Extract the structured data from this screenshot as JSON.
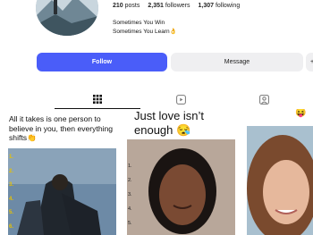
{
  "profile": {
    "posts_count": "210",
    "posts_label": "posts",
    "followers_count": "2,351",
    "followers_label": "followers",
    "following_count": "1,307",
    "following_label": "following",
    "bio_line1": "Sometimes You Win",
    "bio_line2": "Sometimes You Learn👌"
  },
  "actions": {
    "follow_label": "Follow",
    "message_label": "Message",
    "more_label": "+"
  },
  "tabs": [
    {
      "name": "posts",
      "icon": "grid-icon",
      "active": true
    },
    {
      "name": "reels",
      "icon": "reels-icon",
      "active": false
    },
    {
      "name": "tagged",
      "icon": "tagged-icon",
      "active": false
    }
  ],
  "posts": [
    {
      "caption": "All it takes is one person to believe in you, then everything shifts👏",
      "numbers": [
        "1.",
        "2.",
        "3.",
        "4.",
        "5.",
        "6."
      ]
    },
    {
      "caption_line1": "Just love isn’t",
      "caption_line2": "enough 😪",
      "numbers": [
        "1.",
        "2.",
        "3.",
        "4.",
        "5."
      ]
    },
    {
      "emoji": "😝"
    }
  ],
  "colors": {
    "accent": "#4a5df9",
    "secondary_button": "#efeff1"
  }
}
